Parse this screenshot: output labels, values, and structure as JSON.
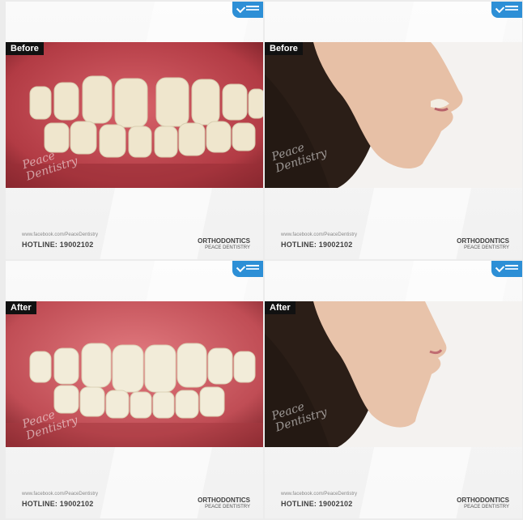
{
  "labels": {
    "before": "Before",
    "after": "After"
  },
  "footer": {
    "facebook": "www.facebook.com/PeaceDentistry",
    "hotline": "HOTLINE: 19002102",
    "service": "ORTHODONTICS",
    "clinic": "PEACE DENTISTRY"
  },
  "watermark": {
    "line1": "Peace",
    "line2": "Dentistry"
  },
  "colors": {
    "brand": "#2d8fd6",
    "gum": "#c2464c",
    "tooth": "#f1ebd8",
    "skin": "#e9c3aa",
    "bg": "#f3f3f3"
  },
  "icons": [
    "peace-dentistry-logo-icon"
  ]
}
